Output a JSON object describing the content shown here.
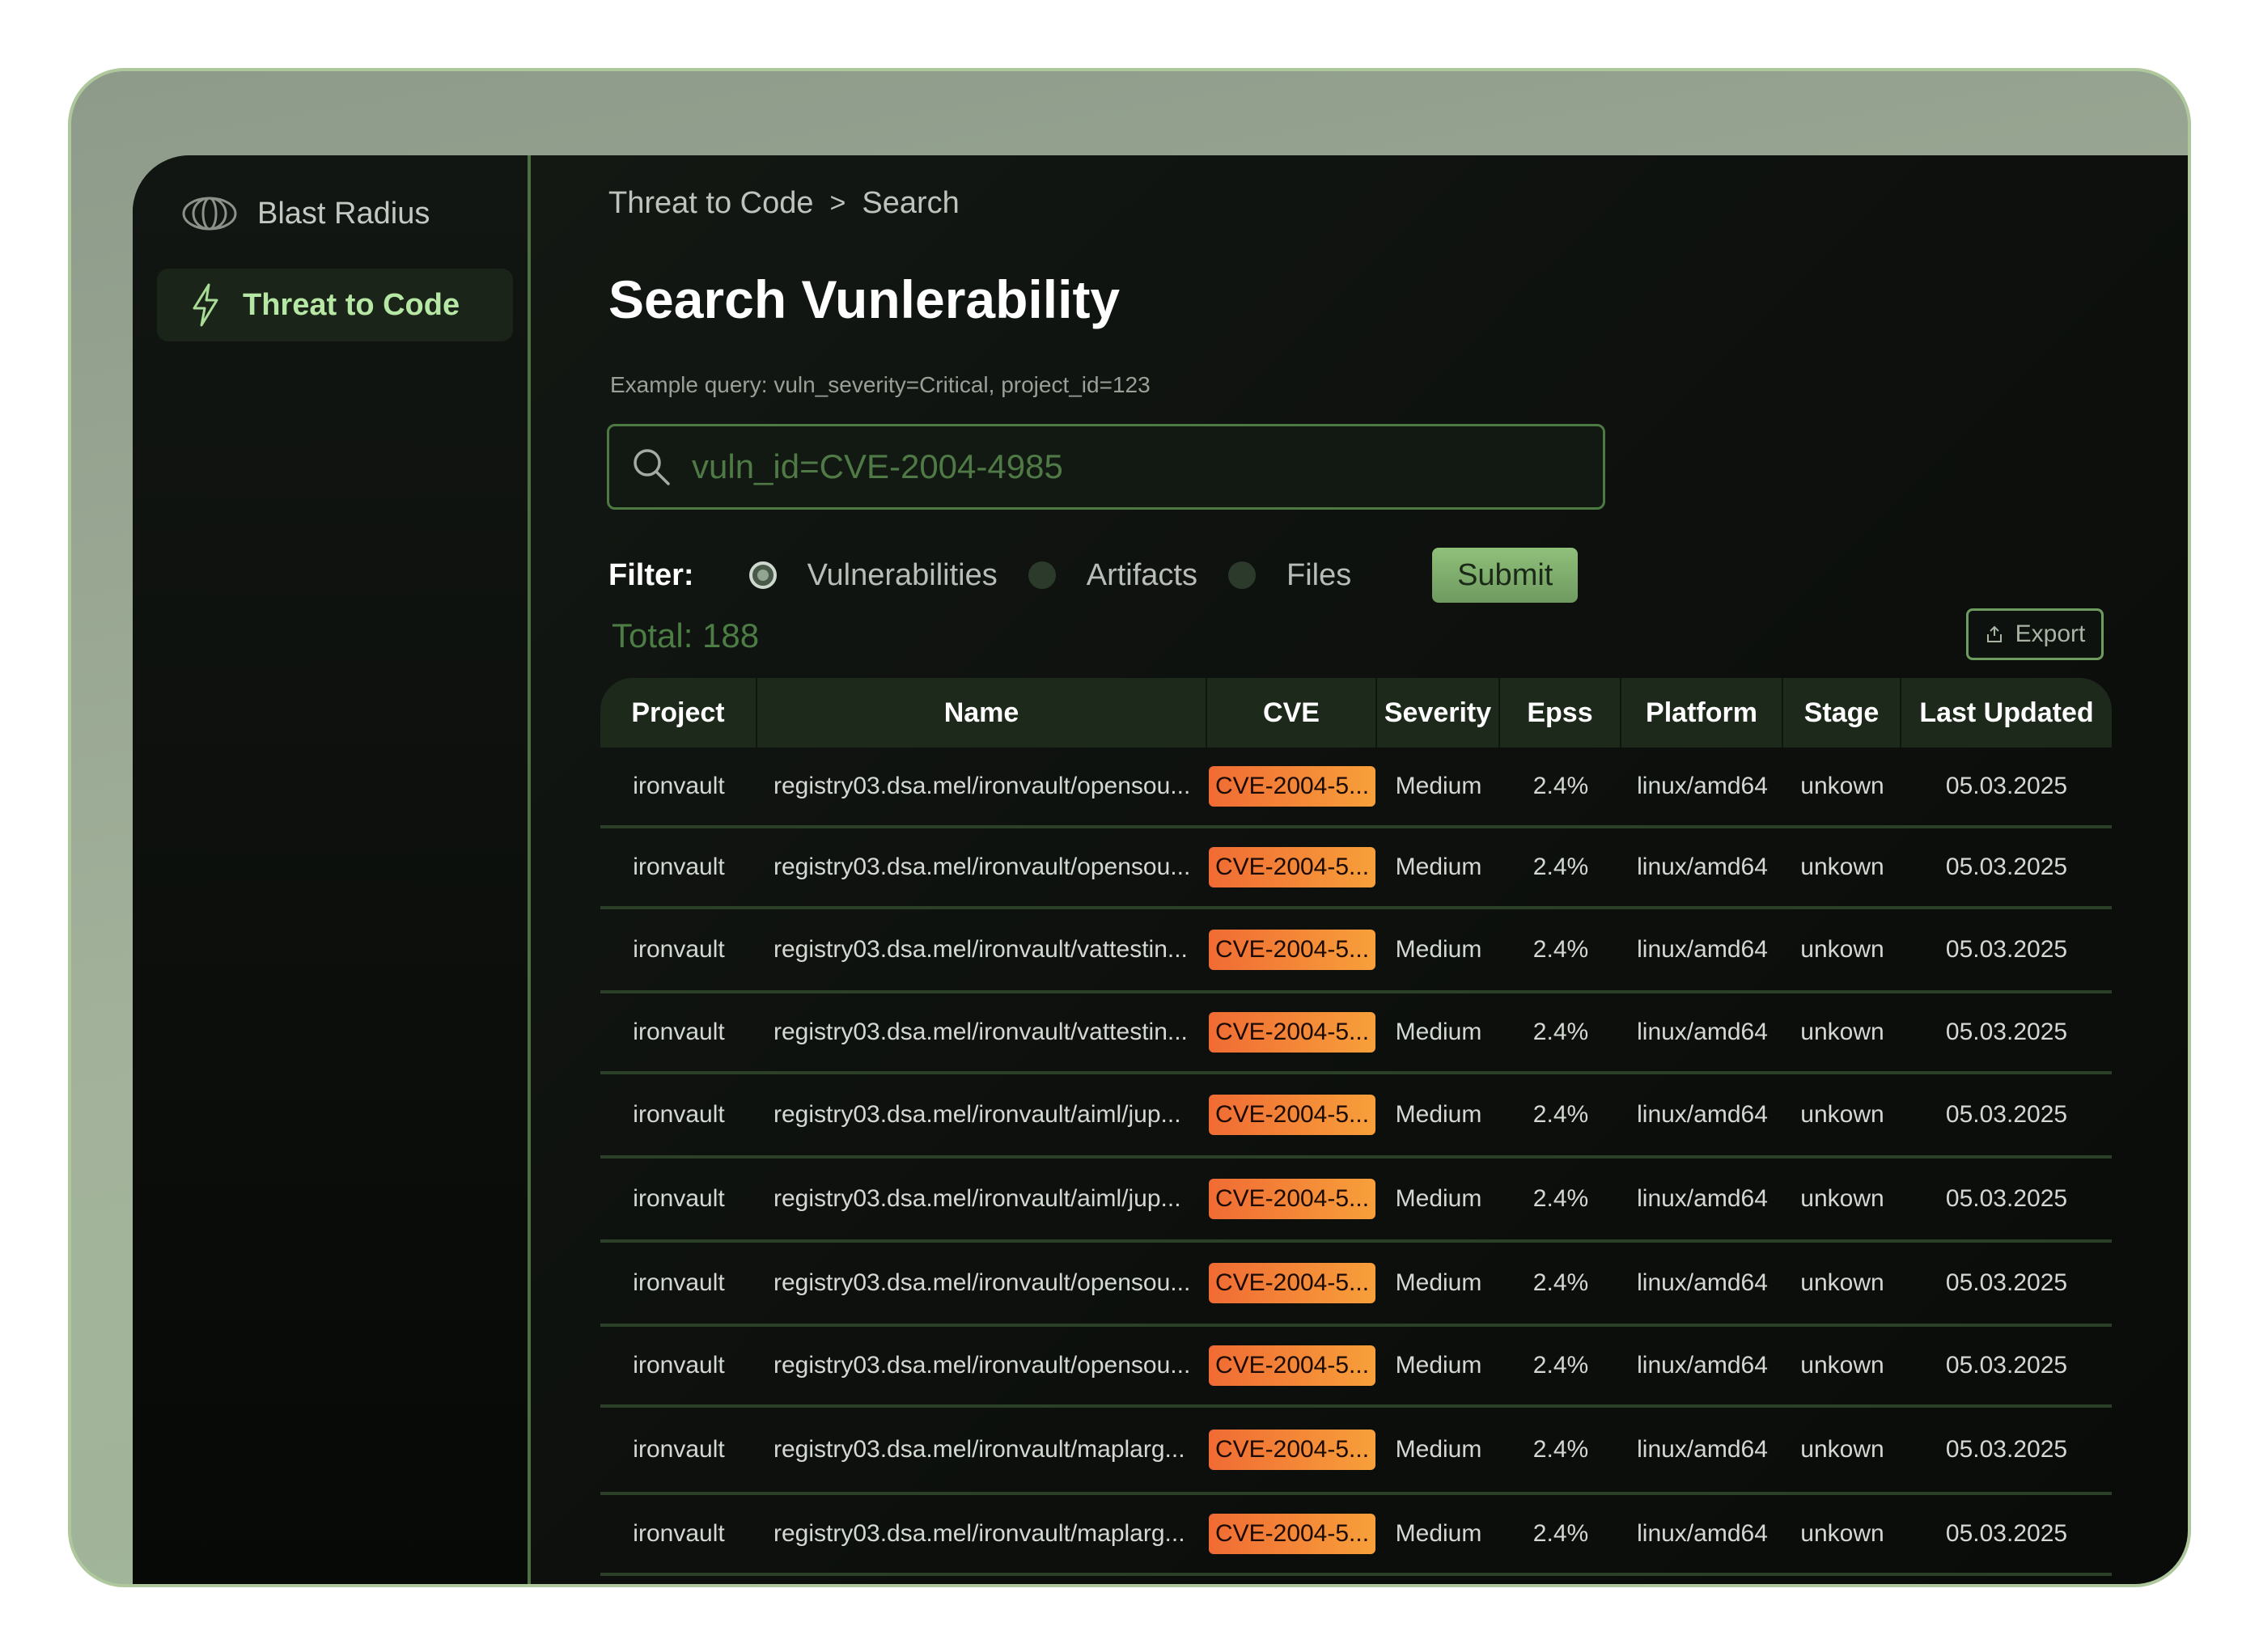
{
  "brand": {
    "name": "Blast Radius"
  },
  "sidebar": {
    "items": [
      {
        "label": "Threat to Code",
        "icon": "lightning-icon",
        "active": true
      }
    ]
  },
  "breadcrumb": {
    "root": "Threat to Code",
    "separator": ">",
    "current": "Search"
  },
  "page": {
    "title": "Search Vunlerability",
    "hint": "Example query: vuln_severity=Critical, project_id=123"
  },
  "search": {
    "value": "vuln_id=CVE-2004-4985"
  },
  "filter": {
    "label": "Filter:",
    "options": [
      {
        "label": "Vulnerabilities",
        "selected": true
      },
      {
        "label": "Artifacts",
        "selected": false
      },
      {
        "label": "Files",
        "selected": false
      }
    ],
    "submit_label": "Submit"
  },
  "total": "Total: 188",
  "export_label": "Export",
  "table": {
    "columns": [
      "Project",
      "Name",
      "CVE",
      "Severity",
      "Epss",
      "Platform",
      "Stage",
      "Last Updated"
    ],
    "rows": [
      [
        "ironvault",
        "registry03.dsa.mel/ironvault/opensou...",
        "CVE-2004-5...",
        "Medium",
        "2.4%",
        "linux/amd64",
        "unkown",
        "05.03.2025"
      ],
      [
        "ironvault",
        "registry03.dsa.mel/ironvault/opensou...",
        "CVE-2004-5...",
        "Medium",
        "2.4%",
        "linux/amd64",
        "unkown",
        "05.03.2025"
      ],
      [
        "ironvault",
        "registry03.dsa.mel/ironvault/vattestin...",
        "CVE-2004-5...",
        "Medium",
        "2.4%",
        "linux/amd64",
        "unkown",
        "05.03.2025"
      ],
      [
        "ironvault",
        "registry03.dsa.mel/ironvault/vattestin...",
        "CVE-2004-5...",
        "Medium",
        "2.4%",
        "linux/amd64",
        "unkown",
        "05.03.2025"
      ],
      [
        "ironvault",
        "registry03.dsa.mel/ironvault/aiml/jup...",
        "CVE-2004-5...",
        "Medium",
        "2.4%",
        "linux/amd64",
        "unkown",
        "05.03.2025"
      ],
      [
        "ironvault",
        "registry03.dsa.mel/ironvault/aiml/jup...",
        "CVE-2004-5...",
        "Medium",
        "2.4%",
        "linux/amd64",
        "unkown",
        "05.03.2025"
      ],
      [
        "ironvault",
        "registry03.dsa.mel/ironvault/opensou...",
        "CVE-2004-5...",
        "Medium",
        "2.4%",
        "linux/amd64",
        "unkown",
        "05.03.2025"
      ],
      [
        "ironvault",
        "registry03.dsa.mel/ironvault/opensou...",
        "CVE-2004-5...",
        "Medium",
        "2.4%",
        "linux/amd64",
        "unkown",
        "05.03.2025"
      ],
      [
        "ironvault",
        "registry03.dsa.mel/ironvault/maplarg...",
        "CVE-2004-5...",
        "Medium",
        "2.4%",
        "linux/amd64",
        "unkown",
        "05.03.2025"
      ],
      [
        "ironvault",
        "registry03.dsa.mel/ironvault/maplarg...",
        "CVE-2004-5...",
        "Medium",
        "2.4%",
        "linux/amd64",
        "unkown",
        "05.03.2025"
      ]
    ]
  },
  "colors": {
    "accent": "#4c7d44",
    "badge_start": "#f06b34",
    "badge_end": "#f7a03a",
    "background": "#0d100d"
  }
}
